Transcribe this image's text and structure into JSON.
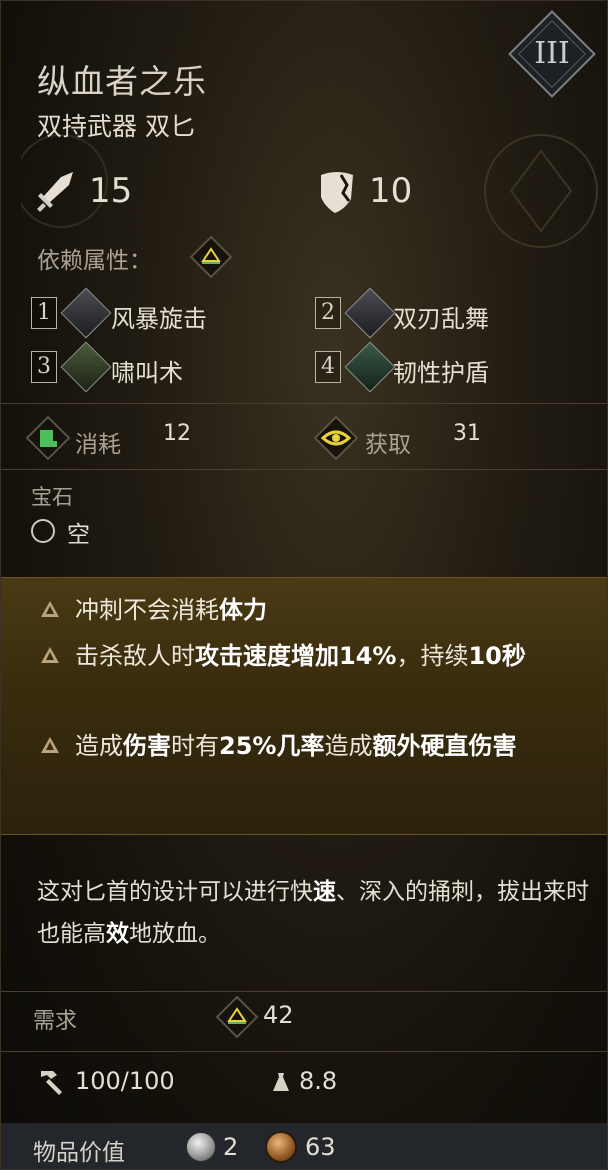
{
  "item": {
    "name": "纵血者之乐",
    "type": "双持武器 双匕",
    "tier": "III"
  },
  "stats": {
    "attack_value": "15",
    "block_value": "10"
  },
  "attribute": {
    "label": "依赖属性："
  },
  "skills": [
    {
      "num": "1",
      "name": "风暴旋击"
    },
    {
      "num": "2",
      "name": "双刃乱舞"
    },
    {
      "num": "3",
      "name": "啸叫术"
    },
    {
      "num": "4",
      "name": "韧性护盾"
    }
  ],
  "resource": {
    "cost_label": "消耗",
    "cost_value": "12",
    "gain_label": "获取",
    "gain_value": "31"
  },
  "gem": {
    "label": "宝石",
    "value": "空"
  },
  "effects": {
    "e1": {
      "a": "冲刺不会消耗",
      "b": "体力"
    },
    "e2": {
      "a": "击杀敌人时",
      "b": "攻击速度增加14%",
      "c": "，持续",
      "d": "10秒"
    },
    "e3": {
      "a": "造成",
      "b": "伤害",
      "c": "时有",
      "d": "25%几率",
      "e": "造成",
      "f": "额外硬直伤害"
    }
  },
  "description": {
    "p1": "这对匕首的设计可以进行快",
    "b1": "速",
    "p2": "、深入的捅刺，拔出来时也能高",
    "b2": "效",
    "p3": "地放血。"
  },
  "requirement": {
    "label": "需求",
    "value": "42"
  },
  "durability": {
    "value": "100/100",
    "weight": "8.8"
  },
  "value_row": {
    "label": "物品价值",
    "silver": "2",
    "copper": "63"
  },
  "colors": {
    "accent_gold": "#c9a227",
    "diamond_green": "#5fb36a",
    "diamond_yellow": "#e8d23a"
  },
  "icons": [
    "sword-icon",
    "shield-icon",
    "attribute-diamond-icon",
    "skill-icon",
    "stamina-cost-icon",
    "eye-gain-icon",
    "gem-slot-icon",
    "effect-bullet-icon",
    "hammer-icon",
    "weight-icon",
    "silver-coin-icon",
    "copper-coin-icon"
  ]
}
